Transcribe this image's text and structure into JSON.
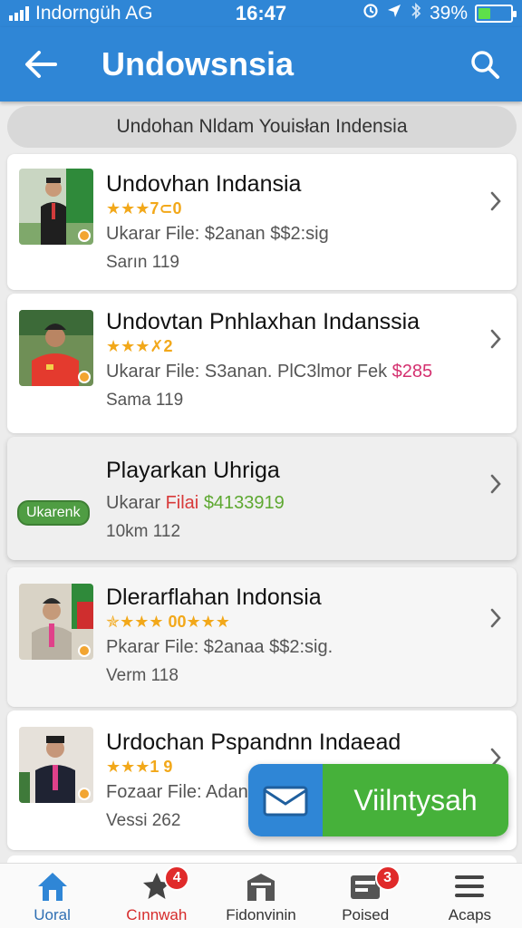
{
  "status_bar": {
    "carrier": "Indorngüh AG",
    "time": "16:47",
    "battery_percent": "39%",
    "battery_level": 0.39,
    "icons": [
      "signal-icon",
      "sync-icon",
      "location-icon",
      "bluetooth-icon",
      "battery-icon"
    ]
  },
  "app_bar": {
    "title": "Undowsnsia",
    "back_icon": "arrow-left-icon",
    "search_icon": "search-icon"
  },
  "sub_header": {
    "text": "Undohan Nldam Youisłan Indensia"
  },
  "colors": {
    "primary": "#2f86d6",
    "accent_green": "#46b13a",
    "star": "#f2a81a",
    "price_pink": "#d4306f",
    "price_green": "#5da830",
    "badge_red": "#e02a2a"
  },
  "list": [
    {
      "title": "Undovhan Indansia",
      "rating": "★★★7⊂0",
      "line_prefix": "Ukarar File: $2anan  $$2:sig",
      "line_price": "",
      "meta": "Sarın 119"
    },
    {
      "title": "Undovtan Pnhlaxhan Indanssia",
      "rating": "★★★✗2",
      "line_prefix": "Ukarar File: S3anan. PlC3lmor Fek",
      "line_price": "$285",
      "meta": "Sama 119"
    },
    {
      "title": "Playarkan Uhriga",
      "tag": "Ukarenk",
      "line_prefix": "Ukarar",
      "line_word": "Filai",
      "line_price": "$4133919",
      "meta": "10km 112"
    },
    {
      "title": "Dlerarflahan Indonsia",
      "rating": "✯★★★ 00★★★",
      "line_prefix": "Pkarar File: $2anaa  $$2:sig.",
      "line_price": "",
      "meta": "Verm 118"
    },
    {
      "title": "Urdochan Pspandnn Indaead",
      "rating": "★★★1  9",
      "line_prefix": "Fozaar File: Adan",
      "line_price": "",
      "meta": "Vessi 262"
    }
  ],
  "floating_banner": {
    "label": "Viilntysah",
    "icon": "mail-icon"
  },
  "bottom_nav": [
    {
      "label": "Uoral",
      "icon": "home-icon",
      "badge": ""
    },
    {
      "label": "Cınnwah",
      "icon": "star-icon",
      "badge": "4"
    },
    {
      "label": "Fidonvinin",
      "icon": "store-icon",
      "badge": ""
    },
    {
      "label": "Poised",
      "icon": "inbox-icon",
      "badge": "3"
    },
    {
      "label": "Acaps",
      "icon": "menu-icon",
      "badge": ""
    }
  ]
}
